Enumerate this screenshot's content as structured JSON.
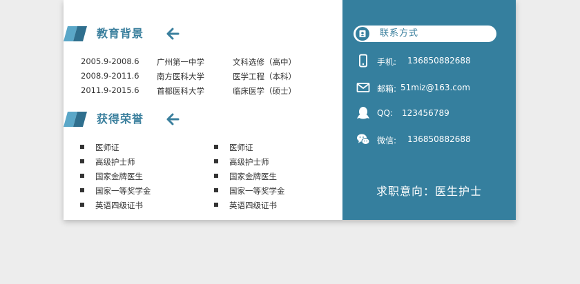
{
  "education": {
    "title": "教育背景",
    "rows": [
      {
        "period": "2005.9-2008.6",
        "school": "广州第一中学",
        "major": "文科选修（高中）"
      },
      {
        "period": "2008.9-2011.6",
        "school": "南方医科大学",
        "major": "医学工程（本科）"
      },
      {
        "period": "2011.9-2015.6",
        "school": "首都医科大学",
        "major": "临床医学（硕士）"
      }
    ]
  },
  "honors": {
    "title": "获得荣誉",
    "left": [
      "医师证",
      "高级护士师",
      "国家金牌医生",
      "国家一等奖学金",
      "英语四级证书"
    ],
    "right": [
      "医师证",
      "高级护士师",
      "国家金牌医生",
      "国家一等奖学金",
      "英语四级证书"
    ]
  },
  "contact": {
    "title": "联系方式",
    "phone_label": "手机:",
    "phone": "136850882688",
    "email_label": "邮箱:",
    "email": "51miz@163.com",
    "qq_label": "QQ:",
    "qq": "123456789",
    "wechat_label": "微信:",
    "wechat": "136850882688"
  },
  "intent": "求职意向：医生护士",
  "colors": {
    "accent": "#357f9e",
    "title_blue": "#3a7f9d",
    "background": "#ededed"
  }
}
